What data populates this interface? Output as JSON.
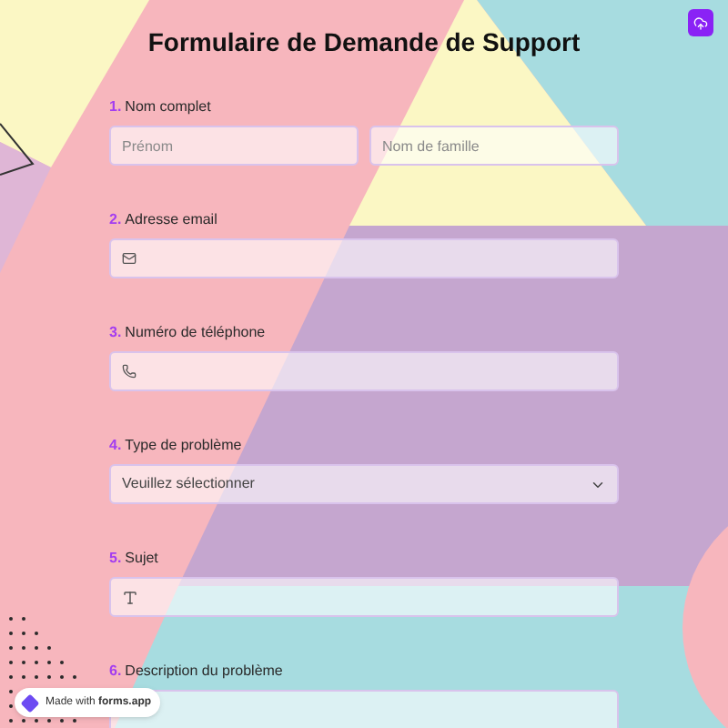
{
  "title": "Formulaire de Demande de Support",
  "fields": [
    {
      "number": "1.",
      "label": "Nom complet",
      "kind": "name",
      "placeholders": [
        "Prénom",
        "Nom de famille"
      ]
    },
    {
      "number": "2.",
      "label": "Adresse email",
      "kind": "email"
    },
    {
      "number": "3.",
      "label": "Numéro de téléphone",
      "kind": "phone"
    },
    {
      "number": "4.",
      "label": "Type de problème",
      "kind": "select",
      "placeholder": "Veuillez sélectionner"
    },
    {
      "number": "5.",
      "label": "Sujet",
      "kind": "text"
    },
    {
      "number": "6.",
      "label": "Description du problème",
      "kind": "textarea"
    }
  ],
  "badge": {
    "text": "Made with **forms.app**"
  }
}
